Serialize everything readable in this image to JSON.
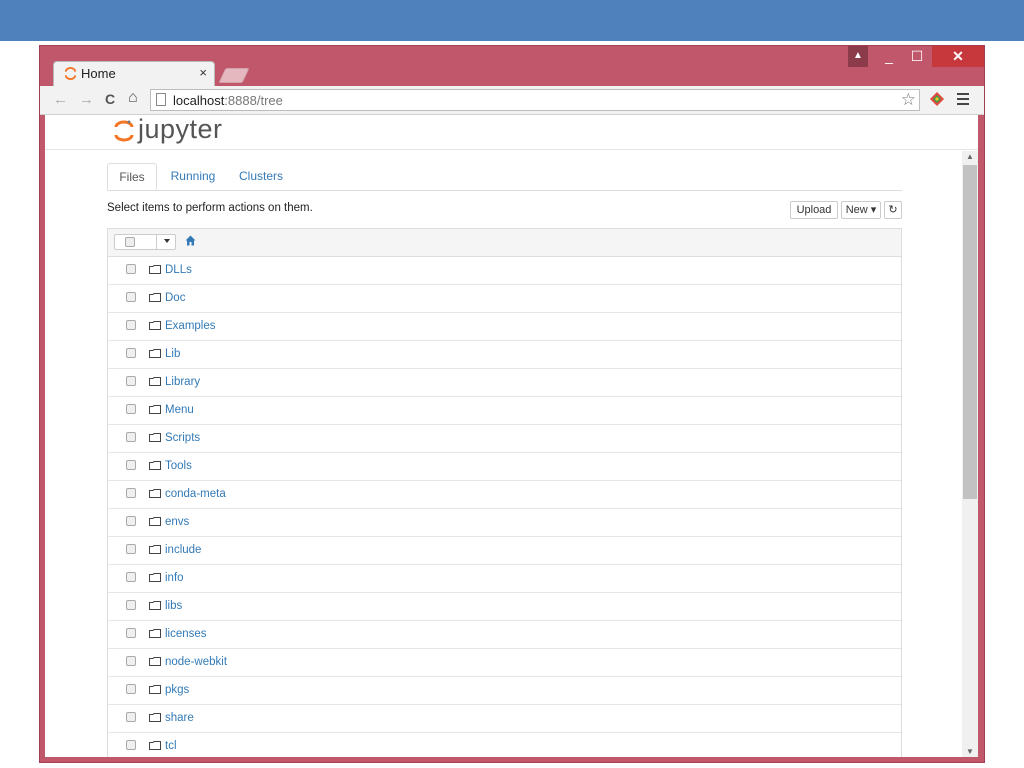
{
  "browser": {
    "tab_title": "Home",
    "tab_close": "×",
    "url_host": "localhost",
    "url_rest": ":8888/tree",
    "window_controls": {
      "user": "▲",
      "minimize": "_",
      "maximize": "☐",
      "close": "✕"
    },
    "nav": {
      "back": "←",
      "forward": "→",
      "reload": "C",
      "home": "⌂"
    },
    "star": "☆"
  },
  "app": {
    "logo_text": "jupyter",
    "accent_color": "#f37626",
    "link_color": "#337ab7"
  },
  "tabs": [
    {
      "label": "Files",
      "active": true
    },
    {
      "label": "Running",
      "active": false
    },
    {
      "label": "Clusters",
      "active": false
    }
  ],
  "toolbar": {
    "info_text": "Select items to perform actions on them.",
    "upload_label": "Upload",
    "new_label": "New ▾",
    "refresh_label": "↻"
  },
  "files": [
    "DLLs",
    "Doc",
    "Examples",
    "Lib",
    "Library",
    "Menu",
    "Scripts",
    "Tools",
    "conda-meta",
    "envs",
    "include",
    "info",
    "libs",
    "licenses",
    "node-webkit",
    "pkgs",
    "share",
    "tcl"
  ]
}
